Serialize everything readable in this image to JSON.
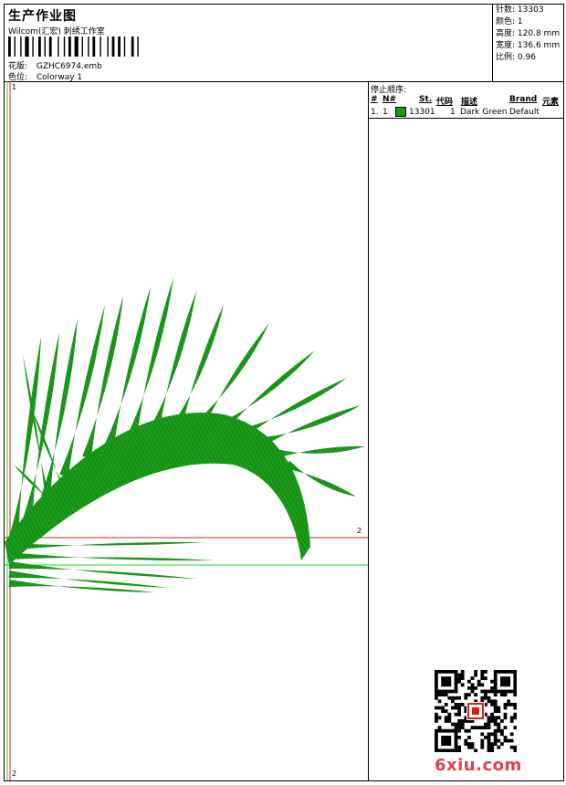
{
  "header": {
    "title": "生产作业图",
    "studio": "Wilcom(汇宏) 刺绣工作室",
    "design_label": "花版:",
    "design_value": "GZHC6974.emb",
    "colorway_label": "色位:",
    "colorway_value": "Colorway 1"
  },
  "specs": [
    {
      "label": "针数:",
      "value": "13303"
    },
    {
      "label": "颜色:",
      "value": "1"
    },
    {
      "label": "高度:",
      "value": "120.8 mm"
    },
    {
      "label": "宽度:",
      "value": "136.6 mm"
    },
    {
      "label": "比例:",
      "value": "0.96"
    }
  ],
  "stop_sequence": {
    "caption": "停止顺序:",
    "columns": [
      "#",
      "N#",
      "St.",
      "代码",
      "描述",
      "Brand",
      "元素"
    ],
    "rows": [
      {
        "index": "1.",
        "n": "1",
        "stitches": "13301",
        "code": "1",
        "description": "Dark Green",
        "brand": "Default",
        "element": ""
      }
    ],
    "swatch_color": "#1a9c1a"
  },
  "guides": {
    "v1": "1",
    "v2": "2",
    "h2": "2"
  },
  "watermark": "6xiu.com",
  "colors": {
    "thread": "#1a9c1a",
    "guide_red": "#d42020",
    "guide_green": "#33cc33"
  }
}
